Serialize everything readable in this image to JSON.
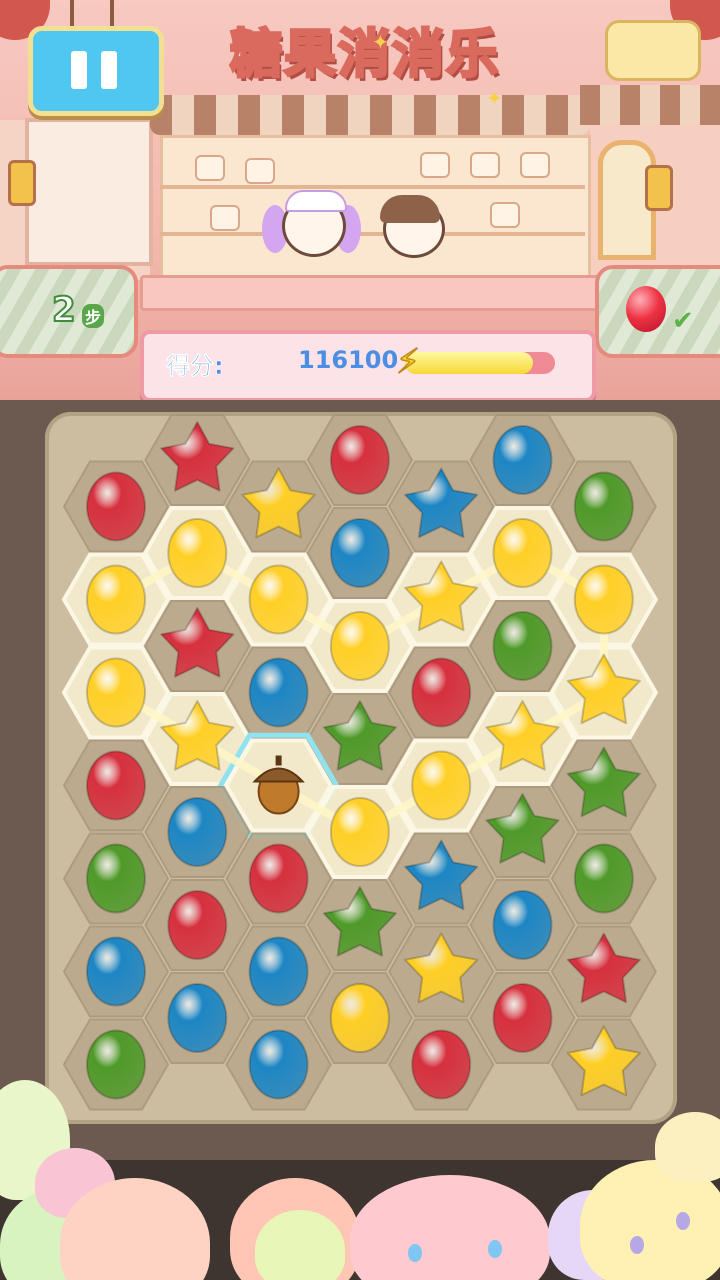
{
  "game": {
    "title": "糖果消消乐",
    "pause_icon": "pause-icon",
    "steps": {
      "value": "2",
      "unit": "步"
    },
    "goal": {
      "candy_color": "red",
      "status_icon": "check-icon"
    },
    "score": {
      "label": "得分:",
      "value": "116100",
      "progress": 0.85
    }
  },
  "colors": {
    "red": "#d6303e",
    "yellow": "#ffcf26",
    "blue": "#1d86c4",
    "green": "#4f9a2a",
    "chain": "#fff7c8"
  },
  "board": {
    "rows": [
      [
        "",
        "red-star",
        "",
        "red",
        "",
        "blue",
        ""
      ],
      [
        "red",
        "",
        "yellow-star",
        "",
        "blue-star",
        "",
        "green"
      ],
      [
        "",
        "yellow",
        "",
        "blue",
        "",
        "yellow",
        ""
      ],
      [
        "yellow",
        "",
        "yellow",
        "",
        "yellow-star",
        "",
        "yellow"
      ],
      [
        "",
        "red-star",
        "",
        "yellow",
        "",
        "green",
        ""
      ],
      [
        "yellow",
        "",
        "blue",
        "",
        "red",
        "",
        "yellow-star"
      ],
      [
        "",
        "yellow-star",
        "",
        "green-star",
        "",
        "yellow-star",
        ""
      ],
      [
        "red",
        "",
        "acorn",
        "",
        "yellow",
        "",
        "green-star"
      ],
      [
        "",
        "blue",
        "",
        "yellow",
        "",
        "green-star",
        ""
      ],
      [
        "green",
        "",
        "red",
        "",
        "blue-star",
        "",
        "green"
      ],
      [
        "",
        "red",
        "",
        "green-star",
        "",
        "blue",
        ""
      ],
      [
        "blue",
        "",
        "blue",
        "",
        "yellow-star",
        "",
        "red-star"
      ],
      [
        "",
        "blue",
        "",
        "yellow",
        "",
        "red",
        ""
      ],
      [
        "green",
        "",
        "blue",
        "",
        "red",
        "",
        "yellow-star"
      ]
    ],
    "chain": [
      [
        3,
        0
      ],
      [
        2,
        1
      ],
      [
        3,
        2
      ],
      [
        4,
        3
      ],
      [
        3,
        4
      ],
      [
        2,
        5
      ],
      [
        3,
        6
      ],
      [
        4,
        6
      ],
      [
        5,
        6
      ],
      [
        6,
        5
      ],
      [
        7,
        4
      ],
      [
        8,
        3
      ],
      [
        7,
        2
      ],
      [
        6,
        1
      ],
      [
        5,
        0
      ]
    ],
    "selected": [
      7,
      2
    ]
  }
}
